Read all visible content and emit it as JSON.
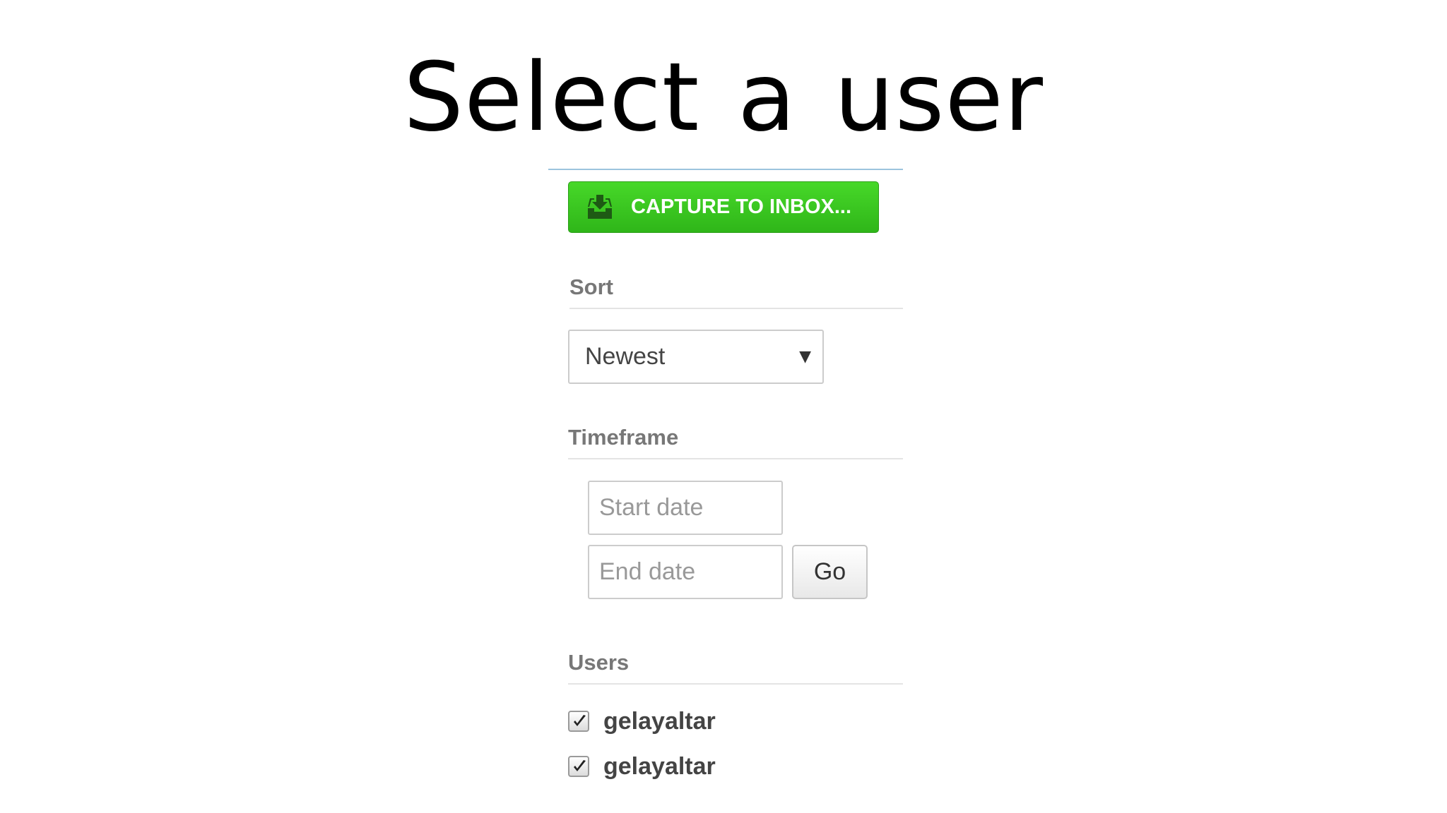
{
  "slide": {
    "title": "Select a user"
  },
  "panel": {
    "capture_button": {
      "label": "CAPTURE TO INBOX...",
      "icon": "inbox-download-icon",
      "color": "#3cc723"
    },
    "sort": {
      "heading": "Sort",
      "selected": "Newest"
    },
    "timeframe": {
      "heading": "Timeframe",
      "start_placeholder": "Start date",
      "end_placeholder": "End date",
      "go_label": "Go"
    },
    "users": {
      "heading": "Users",
      "items": [
        {
          "name": "gelayaltar",
          "checked": true
        },
        {
          "name": "gelayaltar",
          "checked": true
        }
      ]
    }
  },
  "colors": {
    "accent_green": "#3cc723",
    "divider_blue": "#9cc4de",
    "heading_gray": "#777777"
  }
}
